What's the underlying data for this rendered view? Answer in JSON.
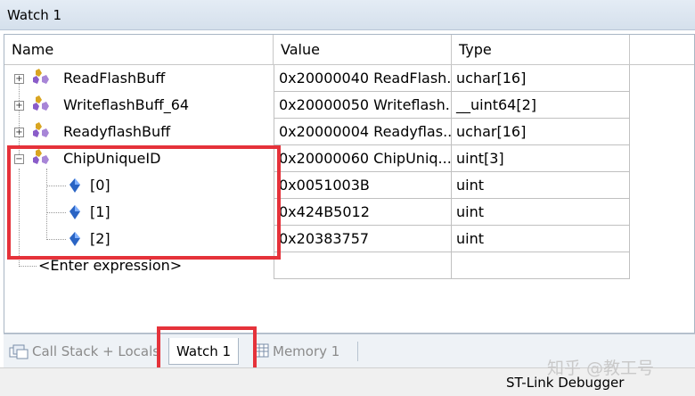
{
  "window": {
    "title": "Watch 1"
  },
  "columns": {
    "name": "Name",
    "value": "Value",
    "type": "Type"
  },
  "rows": [
    {
      "name": "ReadFlashBuff",
      "value": "0x20000040 ReadFlash...",
      "type": "uchar[16]"
    },
    {
      "name": "WriteflashBuff_64",
      "value": "0x20000050 Writeflash...",
      "type": "__uint64[2]"
    },
    {
      "name": "ReadyflashBuff",
      "value": "0x20000004 Readyflas...",
      "type": "uchar[16]"
    },
    {
      "name": "ChipUniqueID",
      "value": "0x20000060 ChipUniq...",
      "type": "uint[3]"
    },
    {
      "name": "[0]",
      "value": "0x0051003B",
      "type": "uint"
    },
    {
      "name": "[1]",
      "value": "0x424B5012",
      "type": "uint"
    },
    {
      "name": "[2]",
      "value": "0x20383757",
      "type": "uint"
    }
  ],
  "enter_expression": "<Enter expression>",
  "icons": {
    "expand": "+",
    "collapse": "−",
    "struct": "struct-variable-icon",
    "element": "element-diamond-icon",
    "callstack": "call-stack-icon",
    "memory": "memory-grid-icon"
  },
  "tabs": [
    {
      "label": "Call Stack + Locals"
    },
    {
      "label": "Watch 1"
    },
    {
      "label": "Memory 1"
    }
  ],
  "status": {
    "debugger": "ST-Link Debugger"
  },
  "watermark": "知乎 @教工号",
  "colors": {
    "highlight": "#e5323a",
    "diamond": "#2a64c4",
    "struct_icon": "#d9a521"
  }
}
